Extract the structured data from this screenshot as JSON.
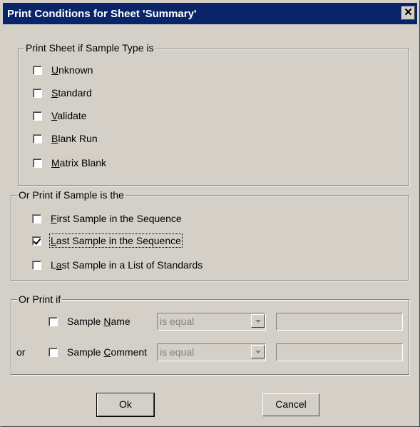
{
  "dialog": {
    "title": "Print Conditions for Sheet 'Summary'",
    "close_glyph": "✕"
  },
  "sample_type_group": {
    "legend": "Print Sheet if Sample Type is",
    "items": [
      {
        "label_prefix": "",
        "mnemonic": "U",
        "label_rest": "nknown",
        "checked": false
      },
      {
        "label_prefix": "",
        "mnemonic": "S",
        "label_rest": "tandard",
        "checked": false
      },
      {
        "label_prefix": "",
        "mnemonic": "V",
        "label_rest": "alidate",
        "checked": false
      },
      {
        "label_prefix": "",
        "mnemonic": "B",
        "label_rest": "lank Run",
        "checked": false
      },
      {
        "label_prefix": "",
        "mnemonic": "M",
        "label_rest": "atrix Blank",
        "checked": false
      }
    ]
  },
  "sample_position_group": {
    "legend": "Or Print if Sample is the",
    "items": [
      {
        "label_prefix": "",
        "mnemonic": "F",
        "label_rest": "irst Sample in the Sequence",
        "checked": false
      },
      {
        "label_prefix": "",
        "mnemonic": "L",
        "label_rest": "ast Sample in the Sequence",
        "checked": true
      },
      {
        "label_prefix": "L",
        "mnemonic": "a",
        "label_rest": "st Sample in a List of Standards",
        "checked": false
      }
    ]
  },
  "or_print_group": {
    "legend": "Or Print if",
    "or_label": "or",
    "rows": [
      {
        "label_prefix": "Sample ",
        "mnemonic": "N",
        "label_rest": "ame",
        "checked": false,
        "operator": "is equal",
        "value": ""
      },
      {
        "label_prefix": "Sample ",
        "mnemonic": "C",
        "label_rest": "omment",
        "checked": false,
        "operator": "is equal",
        "value": ""
      }
    ]
  },
  "buttons": {
    "ok": "Ok",
    "cancel": "Cancel"
  }
}
